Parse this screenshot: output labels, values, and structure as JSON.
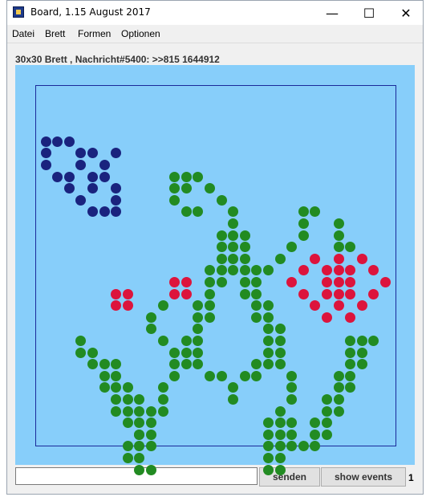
{
  "window": {
    "title": "Board, 1.15 August 2017",
    "minimize_label": "—",
    "maximize_label": "☐",
    "close_label": "✕"
  },
  "menu": [
    "Datei",
    "Brett",
    "Formen",
    "Optionen"
  ],
  "info": "30x30 Brett , Nachricht#5400: >>815 1644912",
  "colors": {
    "board_bg": "#87cefa",
    "navy": "#1a237e",
    "green": "#228b22",
    "red": "#dc143c",
    "grid_border": "#1a2a9a"
  },
  "controls": {
    "message_input_value": "",
    "send_label": "senden",
    "show_events_label": "show events",
    "counter": "1"
  },
  "board": {
    "grid_size": 30,
    "navy_cells": [
      [
        0,
        2
      ],
      [
        1,
        2
      ],
      [
        2,
        2
      ],
      [
        0,
        3
      ],
      [
        3,
        3
      ],
      [
        4,
        3
      ],
      [
        6,
        3
      ],
      [
        0,
        4
      ],
      [
        3,
        4
      ],
      [
        5,
        4
      ],
      [
        1,
        5
      ],
      [
        2,
        5
      ],
      [
        4,
        5
      ],
      [
        5,
        5
      ],
      [
        2,
        6
      ],
      [
        4,
        6
      ],
      [
        6,
        6
      ],
      [
        3,
        7
      ],
      [
        6,
        7
      ],
      [
        4,
        8
      ],
      [
        5,
        8
      ],
      [
        6,
        8
      ]
    ],
    "red_cells": [
      [
        23,
        12
      ],
      [
        25,
        12
      ],
      [
        27,
        12
      ],
      [
        22,
        13
      ],
      [
        24,
        13
      ],
      [
        25,
        13
      ],
      [
        26,
        13
      ],
      [
        28,
        13
      ],
      [
        21,
        14
      ],
      [
        24,
        14
      ],
      [
        25,
        14
      ],
      [
        26,
        14
      ],
      [
        29,
        14
      ],
      [
        22,
        15
      ],
      [
        24,
        15
      ],
      [
        25,
        15
      ],
      [
        26,
        15
      ],
      [
        28,
        15
      ],
      [
        23,
        16
      ],
      [
        25,
        16
      ],
      [
        27,
        16
      ],
      [
        24,
        17
      ],
      [
        26,
        17
      ],
      [
        6,
        15
      ],
      [
        7,
        15
      ],
      [
        11,
        14
      ],
      [
        12,
        14
      ],
      [
        6,
        16
      ],
      [
        7,
        16
      ],
      [
        11,
        15
      ],
      [
        12,
        15
      ]
    ],
    "green_cells": [
      [
        12,
        5
      ],
      [
        13,
        5
      ],
      [
        12,
        6
      ],
      [
        14,
        6
      ],
      [
        11,
        5
      ],
      [
        11,
        6
      ],
      [
        15,
        7
      ],
      [
        11,
        7
      ],
      [
        16,
        8
      ],
      [
        12,
        8
      ],
      [
        13,
        8
      ],
      [
        16,
        9
      ],
      [
        15,
        10
      ],
      [
        16,
        10
      ],
      [
        17,
        10
      ],
      [
        15,
        11
      ],
      [
        16,
        11
      ],
      [
        17,
        11
      ],
      [
        15,
        12
      ],
      [
        16,
        12
      ],
      [
        17,
        12
      ],
      [
        14,
        13
      ],
      [
        15,
        13
      ],
      [
        16,
        13
      ],
      [
        17,
        13
      ],
      [
        18,
        13
      ],
      [
        19,
        13
      ],
      [
        14,
        14
      ],
      [
        15,
        14
      ],
      [
        17,
        14
      ],
      [
        18,
        14
      ],
      [
        14,
        15
      ],
      [
        17,
        15
      ],
      [
        18,
        15
      ],
      [
        13,
        16
      ],
      [
        14,
        16
      ],
      [
        18,
        16
      ],
      [
        19,
        16
      ],
      [
        13,
        17
      ],
      [
        14,
        17
      ],
      [
        18,
        17
      ],
      [
        19,
        17
      ],
      [
        13,
        18
      ],
      [
        19,
        18
      ],
      [
        20,
        18
      ],
      [
        12,
        19
      ],
      [
        13,
        19
      ],
      [
        19,
        19
      ],
      [
        20,
        19
      ],
      [
        11,
        20
      ],
      [
        12,
        20
      ],
      [
        13,
        20
      ],
      [
        19,
        20
      ],
      [
        20,
        20
      ],
      [
        11,
        21
      ],
      [
        12,
        21
      ],
      [
        13,
        21
      ],
      [
        18,
        21
      ],
      [
        19,
        21
      ],
      [
        20,
        21
      ],
      [
        11,
        22
      ],
      [
        14,
        22
      ],
      [
        15,
        22
      ],
      [
        17,
        22
      ],
      [
        18,
        22
      ],
      [
        21,
        22
      ],
      [
        10,
        23
      ],
      [
        16,
        23
      ],
      [
        21,
        23
      ],
      [
        10,
        24
      ],
      [
        16,
        24
      ],
      [
        21,
        24
      ],
      [
        10,
        25
      ],
      [
        9,
        25
      ],
      [
        20,
        25
      ],
      [
        9,
        26
      ],
      [
        19,
        26
      ],
      [
        20,
        26
      ],
      [
        21,
        26
      ],
      [
        9,
        27
      ],
      [
        8,
        27
      ],
      [
        19,
        27
      ],
      [
        20,
        27
      ],
      [
        21,
        27
      ],
      [
        7,
        28
      ],
      [
        8,
        28
      ],
      [
        9,
        28
      ],
      [
        19,
        28
      ],
      [
        20,
        28
      ],
      [
        21,
        28
      ],
      [
        7,
        29
      ],
      [
        8,
        29
      ],
      [
        19,
        29
      ],
      [
        20,
        29
      ],
      [
        8,
        30
      ],
      [
        9,
        30
      ],
      [
        19,
        30
      ],
      [
        20,
        30
      ],
      [
        22,
        8
      ],
      [
        23,
        8
      ],
      [
        22,
        9
      ],
      [
        25,
        9
      ],
      [
        22,
        10
      ],
      [
        25,
        10
      ],
      [
        21,
        11
      ],
      [
        25,
        11
      ],
      [
        20,
        12
      ],
      [
        26,
        11
      ],
      [
        10,
        16
      ],
      [
        9,
        17
      ],
      [
        9,
        18
      ],
      [
        10,
        19
      ],
      [
        3,
        19
      ],
      [
        3,
        20
      ],
      [
        4,
        20
      ],
      [
        4,
        21
      ],
      [
        5,
        21
      ],
      [
        6,
        21
      ],
      [
        5,
        22
      ],
      [
        6,
        22
      ],
      [
        5,
        23
      ],
      [
        6,
        23
      ],
      [
        7,
        23
      ],
      [
        6,
        24
      ],
      [
        7,
        24
      ],
      [
        8,
        24
      ],
      [
        6,
        25
      ],
      [
        7,
        25
      ],
      [
        8,
        25
      ],
      [
        7,
        26
      ],
      [
        8,
        26
      ],
      [
        8,
        27
      ],
      [
        26,
        19
      ],
      [
        27,
        19
      ],
      [
        28,
        19
      ],
      [
        26,
        20
      ],
      [
        27,
        20
      ],
      [
        26,
        21
      ],
      [
        27,
        21
      ],
      [
        25,
        22
      ],
      [
        26,
        22
      ],
      [
        25,
        23
      ],
      [
        26,
        23
      ],
      [
        24,
        24
      ],
      [
        25,
        24
      ],
      [
        24,
        25
      ],
      [
        25,
        25
      ],
      [
        23,
        26
      ],
      [
        24,
        26
      ],
      [
        23,
        27
      ],
      [
        24,
        27
      ],
      [
        22,
        28
      ],
      [
        23,
        28
      ]
    ]
  }
}
